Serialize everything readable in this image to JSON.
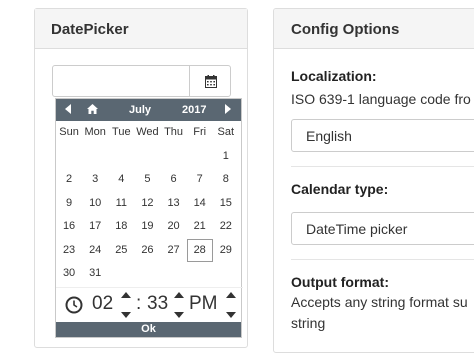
{
  "datepicker_panel": {
    "title": "DatePicker",
    "input_value": ""
  },
  "calendar": {
    "month": "July",
    "year": "2017",
    "weekdays": [
      "Sun",
      "Mon",
      "Tue",
      "Wed",
      "Thu",
      "Fri",
      "Sat"
    ],
    "days": [
      [
        "",
        "",
        "",
        "",
        "",
        "",
        "1"
      ],
      [
        "2",
        "3",
        "4",
        "5",
        "6",
        "7",
        "8"
      ],
      [
        "9",
        "10",
        "11",
        "12",
        "13",
        "14",
        "15"
      ],
      [
        "16",
        "17",
        "18",
        "19",
        "20",
        "21",
        "22"
      ],
      [
        "23",
        "24",
        "25",
        "26",
        "27",
        "28",
        "29"
      ],
      [
        "30",
        "31",
        "",
        "",
        "",
        "",
        ""
      ]
    ],
    "highlighted_day": "28",
    "time": {
      "hour": "02",
      "separator": ":",
      "minute": "33",
      "ampm": "PM"
    },
    "ok_label": "Ok",
    "icons": [
      "chevron-left-icon",
      "home-icon",
      "chevron-right-icon",
      "clock-icon",
      "calendar-icon"
    ]
  },
  "config_panel": {
    "title": "Config Options",
    "localization_label": "Localization:",
    "localization_desc": "ISO 639-1 language code fro",
    "localization_value": "English",
    "calendar_type_label": "Calendar type:",
    "calendar_type_value": "DateTime picker",
    "output_format_label": "Output format:",
    "output_format_desc_1": "Accepts any string format su",
    "output_format_desc_2": "string"
  },
  "colors": {
    "header_bar": "#5a6772",
    "panel_header_bg": "#f5f5f5",
    "border": "#dddddd"
  }
}
